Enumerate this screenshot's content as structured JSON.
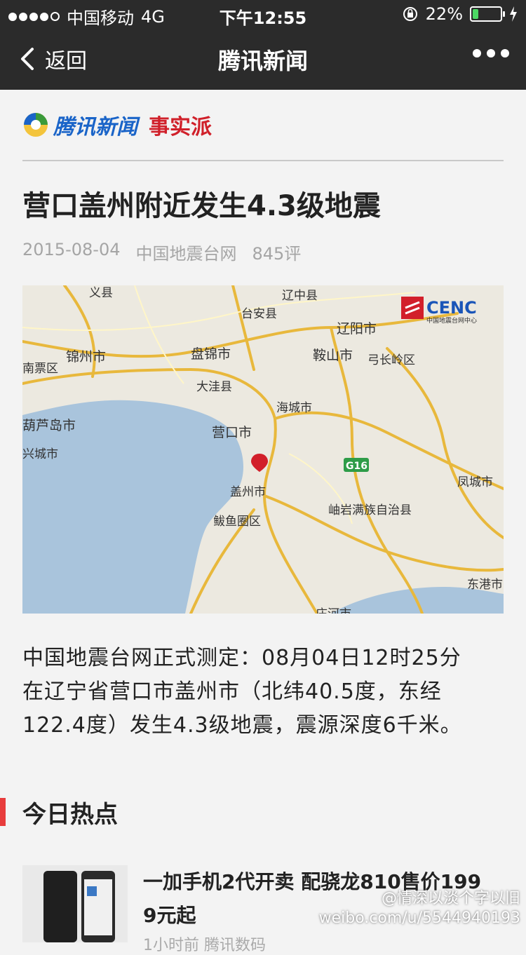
{
  "status": {
    "carrier": "中国移动",
    "network": "4G",
    "time": "下午12:55",
    "battery": "22%",
    "battery_level": 0.22
  },
  "nav": {
    "back_label": "返回",
    "title": "腾讯新闻"
  },
  "brand": {
    "name": "腾讯新闻",
    "sub": "事实派"
  },
  "article": {
    "title": "营口盖州附近发生4.3级地震",
    "date": "2015-08-04",
    "source": "中国地震台网",
    "comments": "845评",
    "body_line1": "中国地震台网正式测定：08月04日12时25分",
    "body_line2": "在辽宁省营口市盖州市（北纬40.5度，东经",
    "body_line3": "122.4度）发生4.3级地震，震源深度6千米。"
  },
  "map": {
    "logo": "CENC",
    "logo_sub": "中国地震台网中心",
    "labels": {
      "yixian": "义县",
      "liaozhong": "辽中县",
      "taian": "台安县",
      "liaoyang": "辽阳市",
      "jinzhou": "锦州市",
      "panjin": "盘锦市",
      "anshan": "鞍山市",
      "gongchangling": "弓长岭区",
      "nanpiao": "南票区",
      "dawa": "大洼县",
      "haicheng": "海城市",
      "huludao": "葫芦岛市",
      "yingkou": "营口市",
      "xingcheng": "兴城市",
      "g16": "G16",
      "gaizhou": "盖州市",
      "fengcheng": "凤城市",
      "xiuyan": "岫岩满族自治县",
      "bayuquan": "鲅鱼圈区",
      "donggang": "东港市",
      "zhuanghe": "庄河市"
    },
    "colors": {
      "sea": "#a9c4dc",
      "land": "#ece9e0",
      "road": "#e8b83c",
      "marker": "#d21f2a"
    }
  },
  "section": {
    "title": "今日热点"
  },
  "news": [
    {
      "title_line1": "一加手机2代开卖 配骁龙810售价199",
      "title_line2": "9元起",
      "meta": "1小时前 腾讯数码"
    }
  ],
  "watermark": {
    "line1": "@情深以淡个字以旧",
    "line2": "weibo.com/u/5544940193"
  }
}
